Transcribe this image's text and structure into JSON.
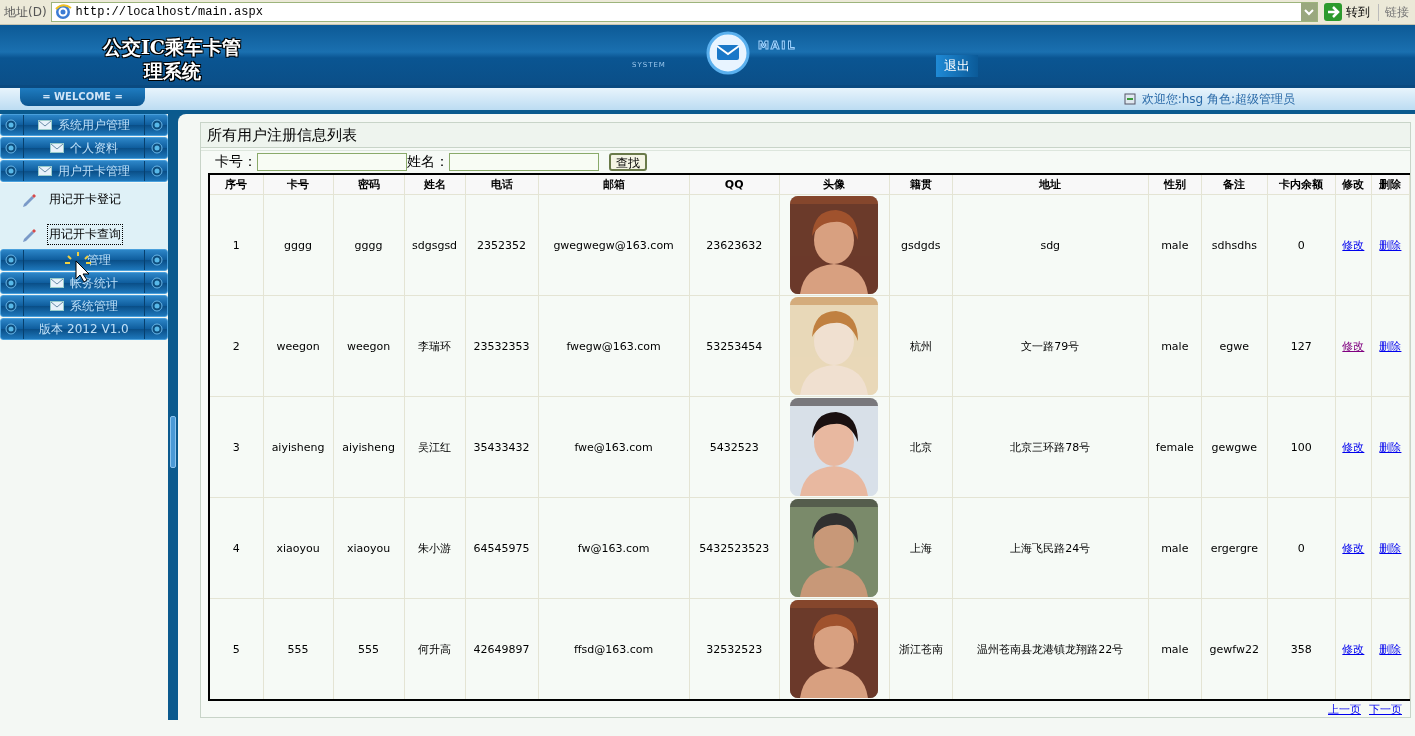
{
  "address_bar": {
    "label": "地址(D)",
    "url": "http://localhost/main.aspx",
    "go_button": "转到",
    "links": "链接"
  },
  "header": {
    "title": "公交IC乘车卡管理系统",
    "system_label": "SYSTEM",
    "mail_label": "MAIL",
    "logout": "退出"
  },
  "welcome_bar": {
    "welcome": "= WELCOME =",
    "user_info": "欢迎您:hsg 角色:超级管理员"
  },
  "sidebar": {
    "items": [
      {
        "kind": "menu",
        "label": "系统用户管理"
      },
      {
        "kind": "menu",
        "label": "个人资料"
      },
      {
        "kind": "menu",
        "label": "用户开卡管理",
        "children": [
          {
            "label": "用记开卡登记",
            "selected": false
          },
          {
            "label": "用记开卡查询",
            "selected": true
          }
        ]
      },
      {
        "kind": "covered",
        "label": "管理"
      },
      {
        "kind": "menu",
        "label": "帐务统计"
      },
      {
        "kind": "menu",
        "label": "系统管理"
      },
      {
        "kind": "version",
        "label": "版本 2012 V1.0"
      }
    ]
  },
  "panel": {
    "title": "所有用户注册信息列表",
    "search": {
      "fields": [
        {
          "label": "卡号："
        },
        {
          "label": "姓名："
        }
      ],
      "button": "查找"
    },
    "table": {
      "columns": [
        "序号",
        "卡号",
        "密码",
        "姓名",
        "电话",
        "邮箱",
        "QQ",
        "头像",
        "籍贯",
        "地址",
        "性别",
        "备注",
        "卡内余额",
        "修改",
        "删除"
      ],
      "rows": [
        {
          "cells": [
            "1",
            "gggg",
            "gggg",
            "sdgsgsd",
            "2352352",
            "gwegwegw@163.com",
            "23623632"
          ],
          "cells2": [
            "gsdgds",
            "sdg",
            "male",
            "sdhsdhs",
            "0"
          ],
          "edit": {
            "label": "修改",
            "visited": false
          },
          "delete": "删除"
        },
        {
          "cells": [
            "2",
            "weegon",
            "weegon",
            "李瑞环",
            "23532353",
            "fwegw@163.com",
            "53253454"
          ],
          "cells2": [
            "杭州",
            "文一路79号",
            "male",
            "egwe",
            "127"
          ],
          "edit": {
            "label": "修改",
            "visited": true
          },
          "delete": "删除"
        },
        {
          "cells": [
            "3",
            "aiyisheng",
            "aiyisheng",
            "吴江红",
            "35433432",
            "fwe@163.com",
            "5432523"
          ],
          "cells2": [
            "北京",
            "北京三环路78号",
            "female",
            "gewgwe",
            "100"
          ],
          "edit": {
            "label": "修改",
            "visited": false
          },
          "delete": "删除"
        },
        {
          "cells": [
            "4",
            "xiaoyou",
            "xiaoyou",
            "朱小游",
            "64545975",
            "fw@163.com",
            "5432523523"
          ],
          "cells2": [
            "上海",
            "上海飞民路24号",
            "male",
            "ergergre",
            "0"
          ],
          "edit": {
            "label": "修改",
            "visited": false
          },
          "delete": "删除"
        },
        {
          "cells": [
            "5",
            "555",
            "555",
            "何升高",
            "42649897",
            "ffsd@163.com",
            "32532523"
          ],
          "cells2": [
            "浙江苍南",
            "温州苍南县龙港镇龙翔路22号",
            "male",
            "gewfw22",
            "358"
          ],
          "edit": {
            "label": "修改",
            "visited": false
          },
          "delete": "删除"
        }
      ]
    },
    "pager": [
      "上一页",
      "下一页"
    ]
  }
}
